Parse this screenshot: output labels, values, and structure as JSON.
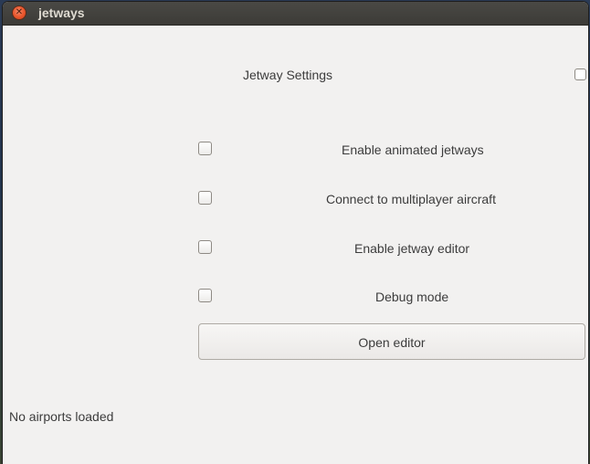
{
  "window": {
    "title": "jetways",
    "close_icon": "close-icon"
  },
  "settings": {
    "heading": "Jetway Settings",
    "options": [
      {
        "label": "Enable animated jetways",
        "checked": false
      },
      {
        "label": "Connect to multiplayer aircraft",
        "checked": false
      },
      {
        "label": "Enable jetway editor",
        "checked": false
      },
      {
        "label": "Debug mode",
        "checked": false
      }
    ],
    "open_editor_label": "Open editor"
  },
  "status": {
    "text": "No airports loaded"
  },
  "colors": {
    "titlebar": "#3c3b37",
    "close_button": "#e9542a",
    "window_bg": "#f2f1f0",
    "text": "#3c3c3c"
  }
}
